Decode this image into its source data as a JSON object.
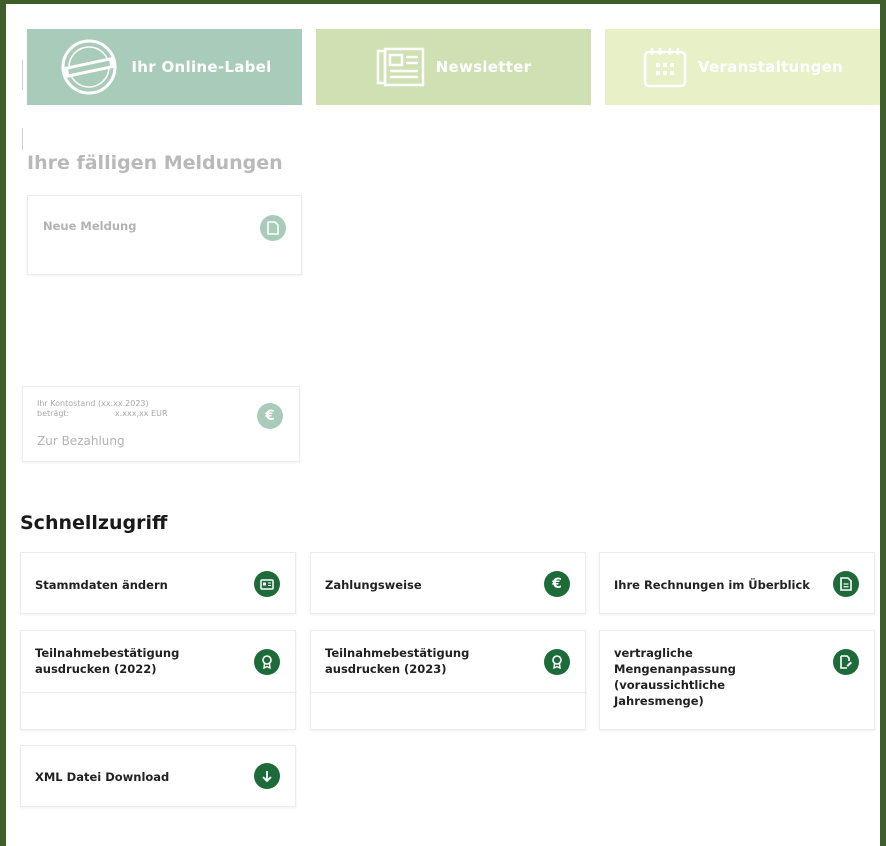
{
  "tiles": [
    {
      "label": "Ihr Online-Label",
      "icon": "badge-seal-icon"
    },
    {
      "label": "Newsletter",
      "icon": "newspaper-icon"
    },
    {
      "label": "Veranstaltungen",
      "icon": "calendar-icon"
    }
  ],
  "due": {
    "heading": "Ihre fälligen Meldungen",
    "new_report": "Neue Meldung",
    "balance_line1": "Ihr Kontostand (xx.xx.2023)",
    "balance_line2_label": "beträgt:",
    "balance_line2_value": "x.xxx,xx EUR",
    "pay_link": "Zur Bezahlung"
  },
  "quick": {
    "heading": "Schnellzugriff",
    "items": [
      {
        "label": "Stammdaten ändern",
        "icon": "id-card-icon"
      },
      {
        "label": "Zahlungsweise",
        "icon": "euro-icon"
      },
      {
        "label": "Ihre Rechnungen im Überblick",
        "icon": "document-icon"
      },
      {
        "label": "Teilnahmebestätigung ausdrucken (2022)",
        "icon": "award-icon"
      },
      {
        "label": "Teilnahmebestätigung ausdrucken (2023)",
        "icon": "award-icon"
      },
      {
        "label": "vertragliche Mengenanpassung (voraussichtliche Jahresmenge)",
        "icon": "edit-document-icon"
      },
      {
        "label": "XML Datei Download",
        "icon": "download-icon"
      }
    ]
  },
  "colors": {
    "brand_dark_green": "#1e6b3a",
    "tile_label": "#a9cbba",
    "tile_newsletter": "#cfe0b3",
    "tile_events": "#e7f0c7",
    "frame": "#3f5f2a"
  }
}
